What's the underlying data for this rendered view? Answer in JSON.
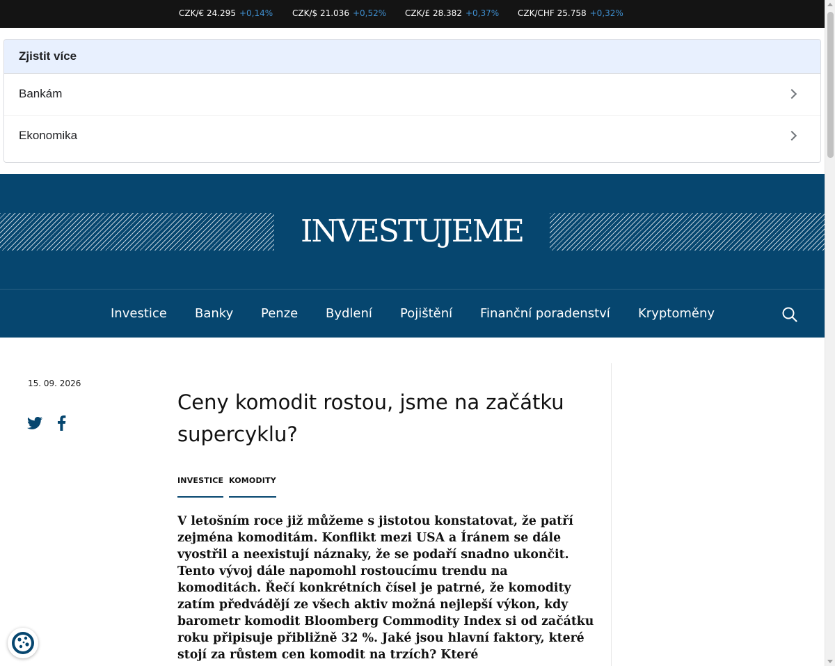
{
  "ticker": [
    {
      "pair": "CZK/€ 24.295",
      "change": "+0,14%"
    },
    {
      "pair": "CZK/$ 21.036",
      "change": "+0,52%"
    },
    {
      "pair": "CZK/£ 28.382",
      "change": "+0,37%"
    },
    {
      "pair": "CZK/CHF 25.758",
      "change": "+0,32%"
    }
  ],
  "learn_more": {
    "heading": "Zjistit více",
    "items": [
      "Bankám",
      "Ekonomika"
    ]
  },
  "brand": {
    "logo": "INVESTUJEME"
  },
  "nav": {
    "items": [
      "Investice",
      "Banky",
      "Penze",
      "Bydlení",
      "Pojištění",
      "Finanční poradenství",
      "Kryptoměny"
    ],
    "search_icon": "search-icon"
  },
  "article": {
    "date": "15. 09. 2026",
    "title": "Ceny komodit rostou, jsme na začátku supercyklu?",
    "tags": [
      "INVESTICE",
      "KOMODITY"
    ],
    "lead": "V letošním roce již můžeme s jistotou konstatovat, že patří zejména komoditám. Konflikt mezi USA a Íránem se dále vyostřil a neexistují náznaky, že se podaří snadno ukončit. Tento vývoj dále napomohl rostoucímu trendu na komoditách. Řečí konkrétních čísel je patrné, že komodity zatím předvádějí ze všech aktiv možná nejlepší výkon, kdy barometr komodit Bloomberg Commodity Index si od začátku roku připisuje přibližně 32 %. Jaké jsou hlavní faktory, které stojí za růstem cen komodit na trzích? Které"
  },
  "colors": {
    "brand": "#06466f",
    "ticker_bg": "#141414",
    "positive": "#3f8fd0",
    "learn_head_bg": "#e8f0fe"
  },
  "icons": [
    "twitter-icon",
    "facebook-icon",
    "search-icon",
    "cookie-icon",
    "chevron-right-icon"
  ]
}
